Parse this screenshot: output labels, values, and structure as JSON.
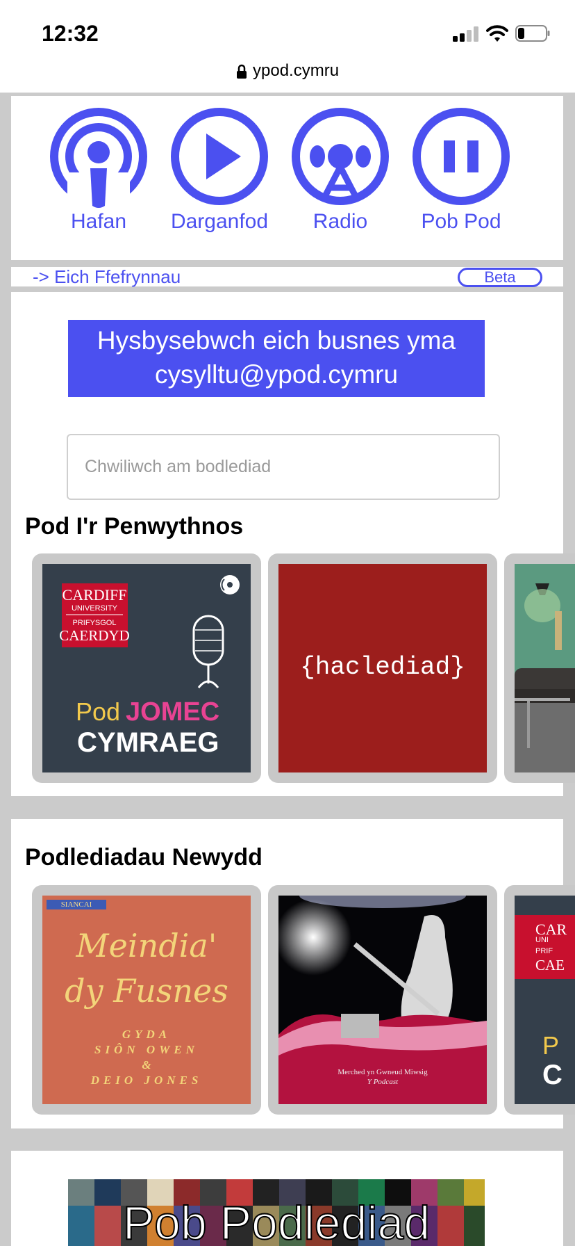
{
  "status_bar": {
    "time": "12:32"
  },
  "browser": {
    "url": "ypod.cymru"
  },
  "nav": {
    "items": [
      {
        "label": "Hafan",
        "icon": "podcast-icon"
      },
      {
        "label": "Darganfod",
        "icon": "play-icon"
      },
      {
        "label": "Radio",
        "icon": "radio-icon"
      },
      {
        "label": "Pob Pod",
        "icon": "pause-icon"
      }
    ]
  },
  "favourites": {
    "link": "-> Eich Ffefrynnau",
    "badge": "Beta"
  },
  "ad": {
    "line1": "Hysbysebwch eich busnes yma",
    "line2": "cysylltu@ypod.cymru"
  },
  "search": {
    "placeholder": "Chwiliwch am bodlediad"
  },
  "weekend": {
    "title": "Pod I'r Penwythnos",
    "cards": [
      {
        "logo_line1": "CARDIFF",
        "logo_line2": "UNIVERSITY",
        "logo_line3": "PRIFYSGOL",
        "logo_line4": "CAERDYD",
        "pod": "Pod",
        "jomec": "JOMEC",
        "cymraeg": "CYMRAEG"
      },
      {
        "title": "{hacledia d}"
      }
    ]
  },
  "new_pods": {
    "title": "Podlediadau Newydd",
    "cards": [
      {
        "tag": "SIANCAI",
        "script1": "Meindia'",
        "script2": "dy Fusnes",
        "byline1": "GYDA",
        "byline2": "SIÔN OWEN",
        "byline3": "&",
        "byline4": "DEIO JONES"
      },
      {
        "caption1": "Merched yn Gwneud Miwsig",
        "caption2": "Y Podcast"
      },
      {
        "logo1": "CAR",
        "logo2": "UNI",
        "logo3": "PRIF",
        "logo4": "CAE",
        "p": "P",
        "c": "C"
      }
    ]
  },
  "all_pods": {
    "label": "Pob Podlediad"
  },
  "colors": {
    "accent": "#4b50f0",
    "weekend_red": "#9c1e1c",
    "jomec_bg": "#343f4b",
    "meindia_bg": "#cf6a50"
  }
}
